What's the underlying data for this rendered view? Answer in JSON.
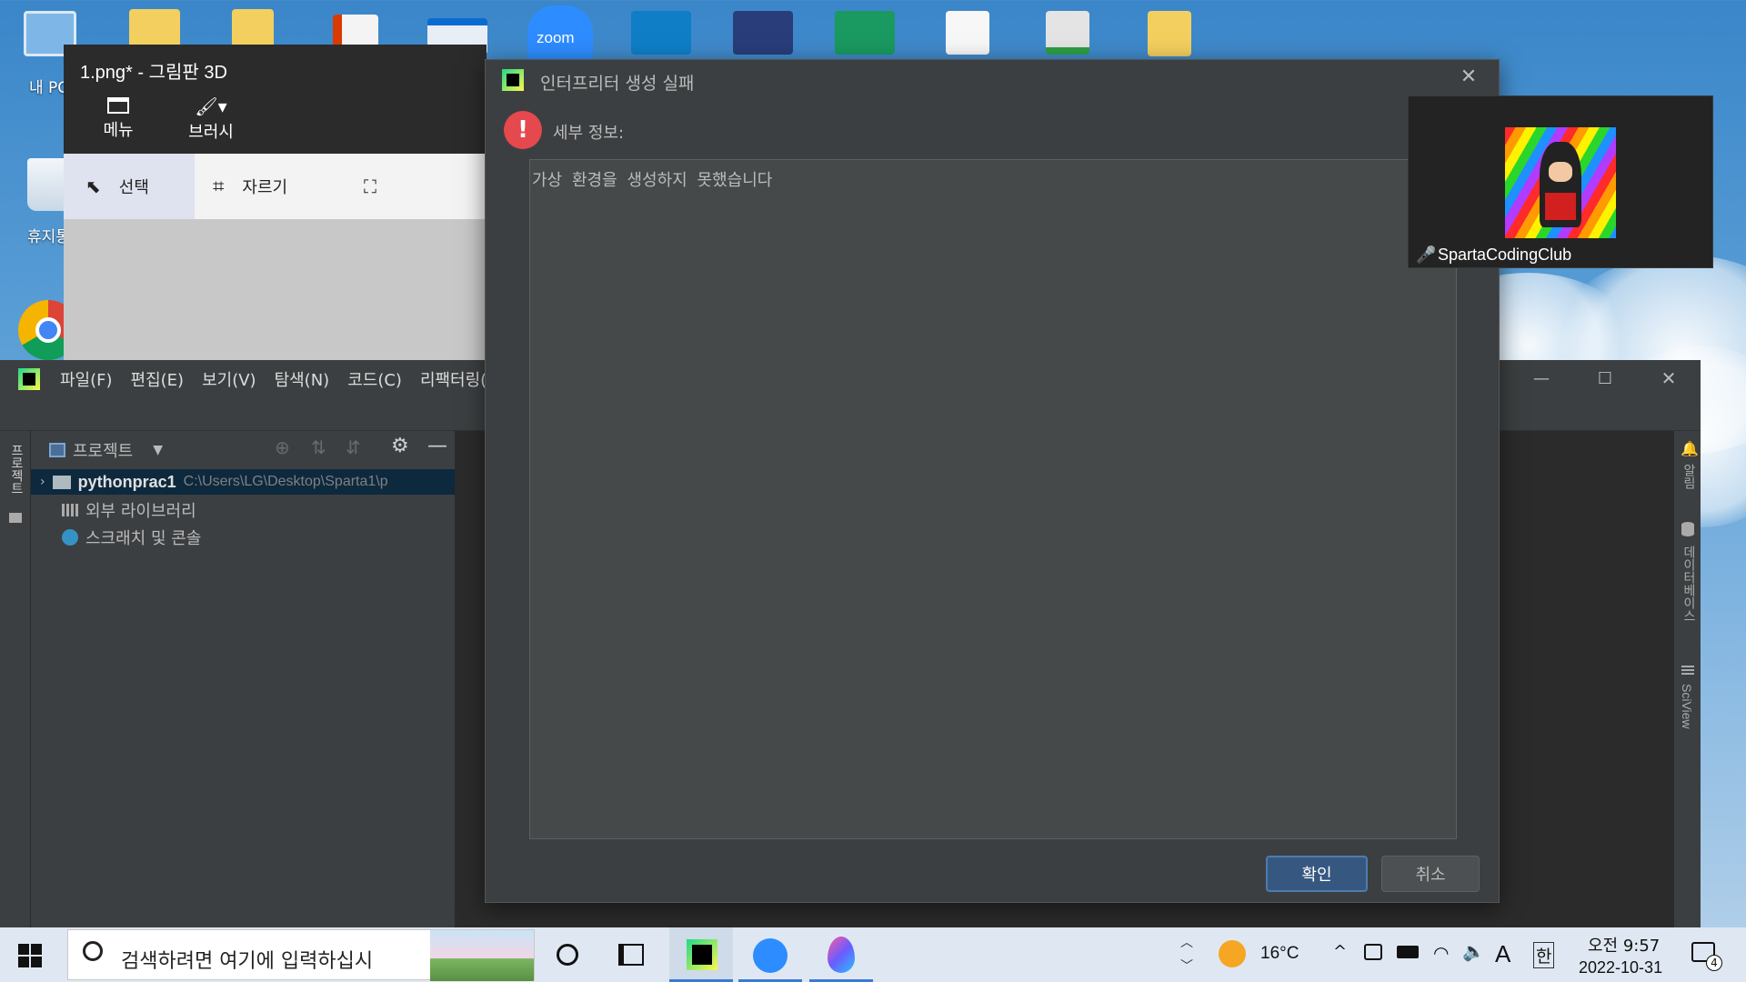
{
  "desktop": {
    "icons": [
      {
        "label": "내 PC",
        "name": "my-pc"
      },
      {
        "label": "휴지통",
        "name": "recycle-bin"
      },
      {
        "label": "",
        "name": "chrome"
      }
    ]
  },
  "paint3d": {
    "title": "1.png* - 그림판 3D",
    "menu_label": "메뉴",
    "brush_label": "브러시",
    "select_label": "선택",
    "crop_label": "자르기"
  },
  "pycharm": {
    "menu": [
      "파일(F)",
      "편집(E)",
      "보기(V)",
      "탐색(N)",
      "코드(C)",
      "리팩터링(R)"
    ],
    "left_strip_label": "프로젝트",
    "project_header": "프로젝트",
    "tree": [
      {
        "label": "pythonprac1",
        "path": "C:\\Users\\LG\\Desktop\\Sparta1\\p"
      },
      {
        "label": "외부 라이브러리"
      },
      {
        "label": "스크래치 및 콘솔"
      }
    ],
    "right_strip": [
      "알림",
      "데이터베이스",
      "SciView"
    ]
  },
  "dialog": {
    "title": "인터프리터 생성 실패",
    "detail_label": "세부 정보:",
    "detail_text": "가상 환경을 생성하지 못했습니다",
    "ok": "확인",
    "cancel": "취소"
  },
  "zoom": {
    "participant": "SpartaCodingClub",
    "tile_label": "zoom"
  },
  "taskbar": {
    "search_placeholder": "검색하려면 여기에 입력하십시",
    "weather": "16°C",
    "ime_lang": "A",
    "ime_mode": "한",
    "time": "오전 9:57",
    "date": "2022-10-31",
    "notification_count": "4"
  },
  "colors": {
    "dialog_bg": "#3c3f41",
    "ok_button": "#365880",
    "error_icon": "#e5484d"
  }
}
